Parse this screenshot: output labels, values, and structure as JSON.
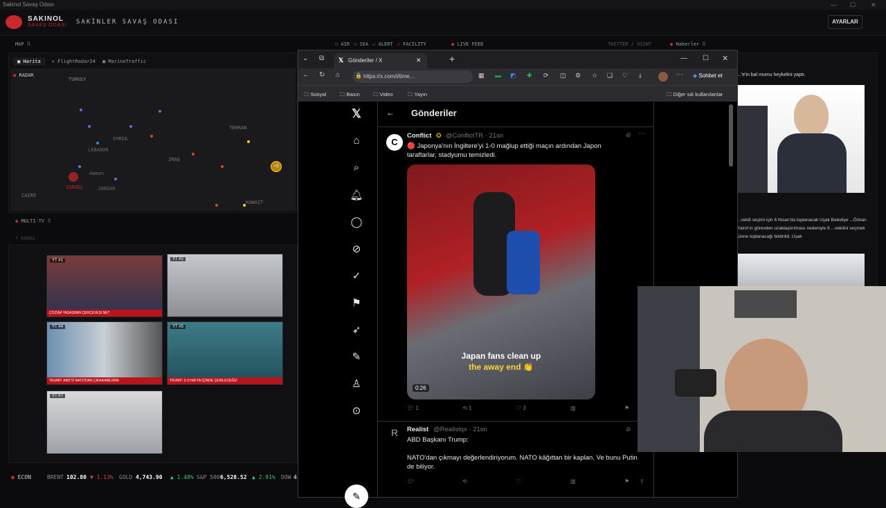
{
  "os": {
    "title": "Sakinol Savaş Odası"
  },
  "app": {
    "brand": "SAKINOL",
    "brand_sub": "SAVAŞ ODASI",
    "title": "SAKİNLER SAVAŞ ODASI",
    "settings": "AYARLAR"
  },
  "filters": [
    {
      "label": "AIR",
      "checked": false
    },
    {
      "label": "SEA",
      "checked": false
    },
    {
      "label": "ALERT",
      "checked": true
    },
    {
      "label": "FACILITY",
      "checked": true
    }
  ],
  "live_feed": "LIVE FEED",
  "twitter_osint": "TWITTER / OSINT",
  "news_header": "Haberler",
  "map_panel": {
    "label": "MAP",
    "tabs": [
      "Harita",
      "FlightRadar24",
      "MarineTraffic"
    ],
    "radar": "RADAR",
    "places": [
      "TURKEY",
      "SYRIA",
      "CAIRO",
      "ISRAEL",
      "TEHRAN",
      "IRAQ",
      "KUWAIT",
      "LEBANON",
      "JORDAN",
      "Amman"
    ],
    "cluster_label": "+2"
  },
  "multitv": {
    "label": "MULTI-TV",
    "sub": "7 KANAL",
    "channels": [
      {
        "tag": "YT #1",
        "caption": "ÇÖZÜM YASASININ ÇERÇEVESİ NE?"
      },
      {
        "tag": "YT #2",
        "caption": ""
      },
      {
        "tag": "YT #4",
        "caption": "TRUMP: ABD'Yİ NATO'DAN ÇIKARABİLİRİM"
      },
      {
        "tag": "YT #5",
        "caption": "TRUMP: 2-3 HAFTA İÇİNDE ÇEKİLECEĞİZ"
      },
      {
        "tag": "YT #7",
        "caption": ""
      }
    ]
  },
  "ticker": {
    "label": "ECON",
    "items": [
      {
        "name": "BRENT",
        "value": "102.80",
        "change": "▼ 1.13%",
        "dir": "down"
      },
      {
        "name": "GOLD",
        "value": "4,743.90",
        "change": "▲ 1.48%",
        "dir": "up"
      },
      {
        "name": "S&P 500",
        "value": "6,528.52",
        "change": "▲ 2.91%",
        "dir": "up"
      },
      {
        "name": "DOW",
        "value": "4",
        "change": "",
        "dir": "up"
      }
    ]
  },
  "browser": {
    "tab_title": "Gönderiler / X",
    "url": "https://x.com/i/time...",
    "bookmarks": [
      "Sosyal",
      "Basın",
      "Video",
      "Yayın"
    ],
    "other_bookmarks": "Diğer sık kullanılanlar",
    "copilot": "Sohbet et"
  },
  "x": {
    "header": "Gönderiler",
    "tweets": [
      {
        "name": "Conflict",
        "handle": "@ConflictTR · 21sn",
        "text": "🔴 Japonya'nın İngiltere'yi 1-0 mağlup ettiği maçın ardından Japon taraftarlar, stadyumu temizledi.",
        "video_caption_1": "Japan fans clean up",
        "video_caption_2": "the away end 👏",
        "duration": "0:26",
        "replies": "1",
        "retweets": "1",
        "likes": "3"
      },
      {
        "name": "Realist",
        "handle": "@Realistqx · 21sn",
        "text1": "ABD Başkanı Trump:",
        "text2": "NATO'dan çıkmayı değerlendiriyorum. NATO kâğıttan bir kaplan. Ve bunu Putin de biliyor."
      }
    ]
  },
  "news": {
    "item1": "...'e'in bal mumu heykelini yaptı.",
    "item2": "...vekili seçimi için 6 Nisan'da toplanacak Uşak Belediye ...Özkan Yalım'ın görevden uzaklaştırılması nedeniyle 6 ...vekilini seçmek üzere toplanacağı bildirildi. Uşak"
  },
  "colors": {
    "accent": "#c8282e",
    "x_bg": "#000000",
    "app_bg": "#0b0b0d"
  }
}
